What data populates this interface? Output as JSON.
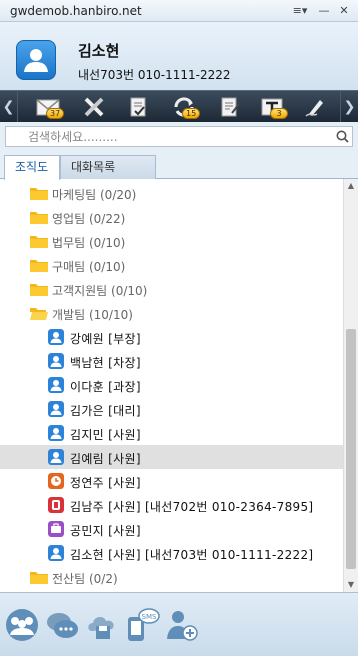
{
  "window": {
    "title": "gwdemob.hanbiro.net",
    "menu_glyph": "≡▾",
    "minimize_glyph": "—",
    "close_glyph": "✕"
  },
  "profile": {
    "name": "김소현",
    "extension": "내선703번 010-1111-2222"
  },
  "toolbar": {
    "left_arrow": "❮",
    "right_arrow": "❯",
    "buttons": [
      {
        "icon": "mail-icon",
        "badge": "37"
      },
      {
        "icon": "tools-icon",
        "badge": ""
      },
      {
        "icon": "approval-icon",
        "badge": ""
      },
      {
        "icon": "sync-icon",
        "badge": "15"
      },
      {
        "icon": "board-icon",
        "badge": ""
      },
      {
        "icon": "schedule-icon",
        "badge": "3"
      },
      {
        "icon": "signature-icon",
        "badge": ""
      }
    ]
  },
  "search": {
    "placeholder": "검색하세요.........",
    "value": ""
  },
  "tabs": [
    {
      "label": "조직도",
      "active": true
    },
    {
      "label": "대화목록",
      "active": false
    }
  ],
  "tree": {
    "departments_top": [
      {
        "name": "마케팅팀",
        "count": "(0/20)"
      },
      {
        "name": "영업팀",
        "count": "(0/22)"
      },
      {
        "name": "법무팀",
        "count": "(0/10)"
      },
      {
        "name": "구매팀",
        "count": "(0/10)"
      },
      {
        "name": "고객지원팀",
        "count": "(0/10)"
      }
    ],
    "open_department": {
      "name": "개발팀",
      "count": "(10/10)"
    },
    "members": [
      {
        "name": "강예원",
        "rank": "[부장]",
        "extra": "",
        "status": "blue"
      },
      {
        "name": "백남현",
        "rank": "[차장]",
        "extra": "",
        "status": "blue"
      },
      {
        "name": "이다훈",
        "rank": "[과장]",
        "extra": "",
        "status": "blue"
      },
      {
        "name": "김가은",
        "rank": "[대리]",
        "extra": "",
        "status": "blue"
      },
      {
        "name": "김지민",
        "rank": "[사원]",
        "extra": "",
        "status": "blue"
      },
      {
        "name": "김예림",
        "rank": "[사원]",
        "extra": "",
        "status": "blue",
        "selected": true
      },
      {
        "name": "정연주",
        "rank": "[사원]",
        "extra": "",
        "status": "orange"
      },
      {
        "name": "김남주",
        "rank": "[사원]",
        "extra": "[내선702번 010-2364-7895]",
        "status": "red"
      },
      {
        "name": "공민지",
        "rank": "[사원]",
        "extra": "",
        "status": "purple"
      },
      {
        "name": "김소현",
        "rank": "[사원]",
        "extra": "[내선703번 010-1111-2222]",
        "status": "blue"
      }
    ],
    "departments_bottom": [
      {
        "name": "전산팀",
        "count": "(0/2)"
      }
    ]
  },
  "colors": {
    "blue": "#2d83d8",
    "orange": "#e2661f",
    "red": "#d8323a",
    "purple": "#9b4fc4",
    "folder": "#f4b71c"
  },
  "bottom_bar": {
    "buttons": [
      "group-chat-icon",
      "chat-icon",
      "file-share-icon",
      "sms-icon",
      "add-user-icon"
    ]
  }
}
